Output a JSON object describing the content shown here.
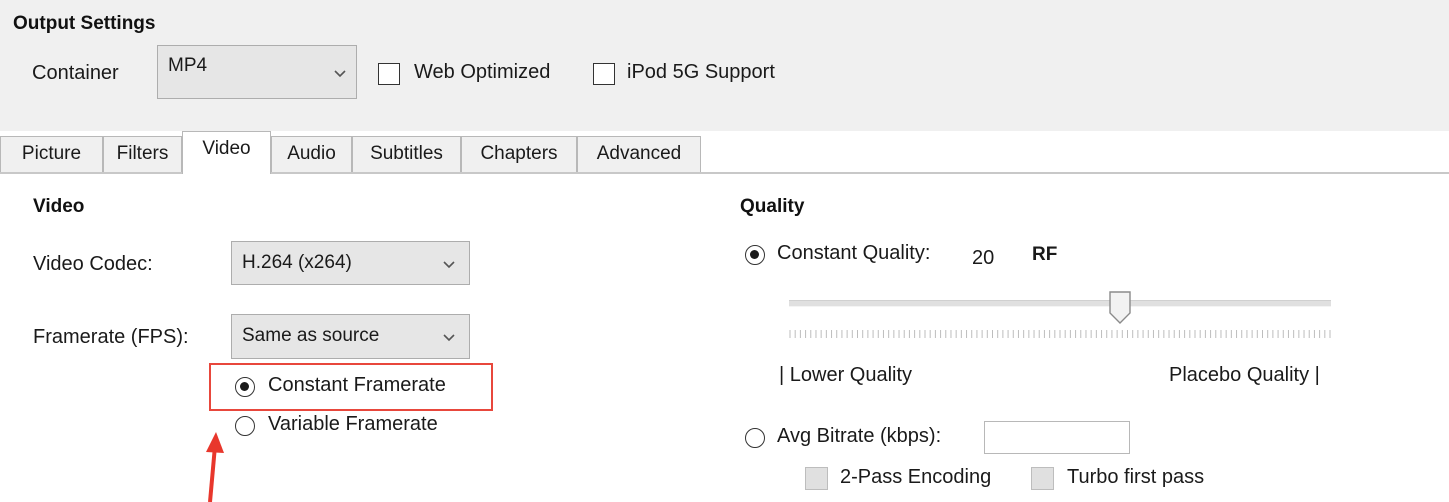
{
  "output_settings": {
    "title": "Output Settings",
    "container_label": "Container",
    "container_value": "MP4",
    "web_optimized_label": "Web Optimized",
    "web_optimized_checked": false,
    "ipod_label": "iPod 5G Support",
    "ipod_checked": false
  },
  "tabs": [
    {
      "label": "Picture",
      "active": false
    },
    {
      "label": "Filters",
      "active": false
    },
    {
      "label": "Video",
      "active": true
    },
    {
      "label": "Audio",
      "active": false
    },
    {
      "label": "Subtitles",
      "active": false
    },
    {
      "label": "Chapters",
      "active": false
    },
    {
      "label": "Advanced",
      "active": false
    }
  ],
  "video": {
    "heading": "Video",
    "codec_label": "Video Codec:",
    "codec_value": "H.264 (x264)",
    "framerate_label": "Framerate (FPS):",
    "framerate_value": "Same as source",
    "constant_framerate_label": "Constant Framerate",
    "variable_framerate_label": "Variable Framerate",
    "selected_framerate_mode": "constant"
  },
  "quality": {
    "heading": "Quality",
    "constant_quality_label": "Constant Quality:",
    "constant_quality_value": "20",
    "rf_label": "RF",
    "slider_level": 0.6,
    "lower_label": "| Lower Quality",
    "upper_label": "Placebo Quality |",
    "avg_bitrate_label": "Avg Bitrate (kbps):",
    "avg_bitrate_value": "",
    "two_pass_label": "2-Pass Encoding",
    "turbo_label": "Turbo first pass",
    "selected_mode": "constant_quality"
  },
  "colors": {
    "highlight": "#e8473c",
    "arrow": "#e8372c"
  }
}
